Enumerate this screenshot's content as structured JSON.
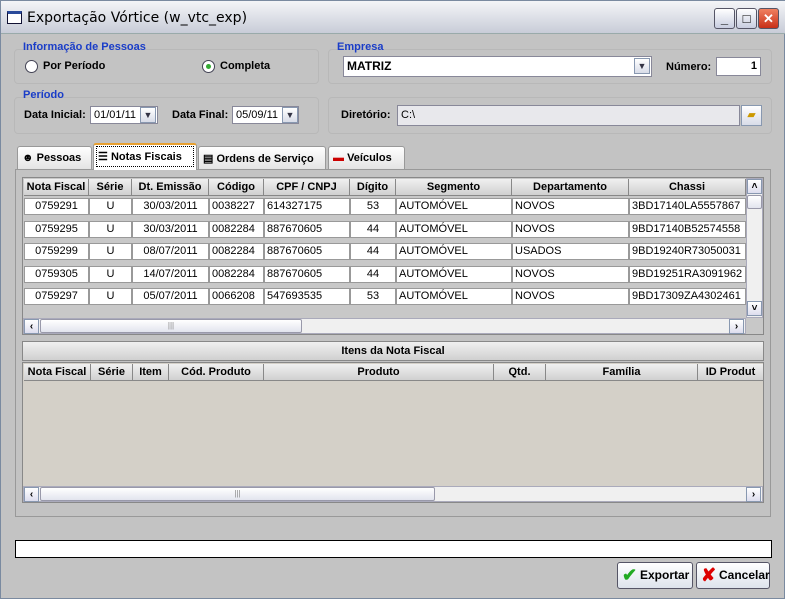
{
  "window": {
    "title": "Exportação Vórtice (w_vtc_exp)",
    "minimize": "_",
    "maximize": "□",
    "close": "✕"
  },
  "pessoas": {
    "label": "Informação de Pessoas",
    "options": [
      {
        "label": "Por Período",
        "selected": false
      },
      {
        "label": "Completa",
        "selected": true
      }
    ]
  },
  "empresa": {
    "label": "Empresa",
    "value": "MATRIZ",
    "numero_label": "Número:",
    "numero_value": "1"
  },
  "periodo": {
    "label": "Período",
    "data_inicial_label": "Data Inicial:",
    "data_inicial": "01/01/11",
    "data_final_label": "Data Final:",
    "data_final": "05/09/11"
  },
  "diretorio": {
    "label": "Diretório:",
    "value": "C:\\"
  },
  "tabs": [
    {
      "label": "Pessoas",
      "icon": "person-icon"
    },
    {
      "label": "Notas Fiscais",
      "icon": "list-icon",
      "active": true
    },
    {
      "label": "Ordens de Serviço",
      "icon": "document-icon"
    },
    {
      "label": "Veículos",
      "icon": "car-icon"
    }
  ],
  "notas": {
    "columns": [
      "Nota Fiscal",
      "Série",
      "Dt. Emissão",
      "Código",
      "CPF / CNPJ",
      "Dígito",
      "Segmento",
      "Departamento",
      "Chassi"
    ],
    "rows": [
      [
        "0759291",
        "U",
        "30/03/2011",
        "0038227",
        "614327175",
        "53",
        "AUTOMÓVEL",
        "NOVOS",
        "3BD17140LA5557867"
      ],
      [
        "0759295",
        "U",
        "30/03/2011",
        "0082284",
        "887670605",
        "44",
        "AUTOMÓVEL",
        "NOVOS",
        "9BD17140B52574558"
      ],
      [
        "0759299",
        "U",
        "08/07/2011",
        "0082284",
        "887670605",
        "44",
        "AUTOMÓVEL",
        "USADOS",
        "9BD19240R73050031"
      ],
      [
        "0759305",
        "U",
        "14/07/2011",
        "0082284",
        "887670605",
        "44",
        "AUTOMÓVEL",
        "NOVOS",
        "9BD19251RA3091962"
      ],
      [
        "0759297",
        "U",
        "05/07/2011",
        "0066208",
        "547693535",
        "53",
        "AUTOMÓVEL",
        "NOVOS",
        "9BD17309ZA4302461"
      ]
    ]
  },
  "itens": {
    "title": "Itens da Nota Fiscal",
    "columns": [
      "Nota Fiscal",
      "Série",
      "Item",
      "Cód. Produto",
      "Produto",
      "Qtd.",
      "Família",
      "ID Produt"
    ]
  },
  "status": "",
  "buttons": {
    "exportar": "Exportar",
    "cancelar": "Cancelar"
  },
  "colors": {
    "group_label": "#1a3dc8",
    "active_tab": "#e8a030"
  }
}
